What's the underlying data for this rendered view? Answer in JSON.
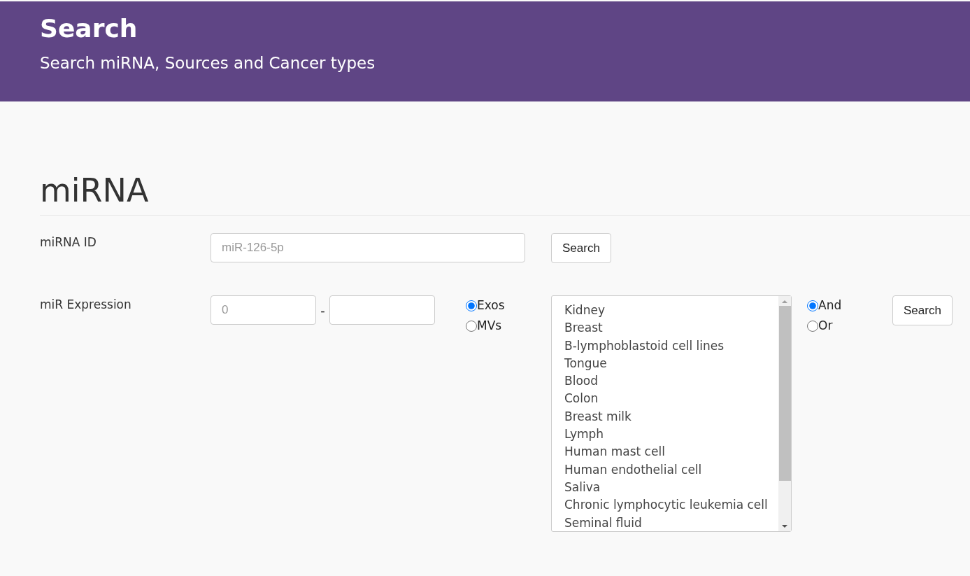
{
  "header": {
    "title": "Search",
    "subtitle": "Search miRNA, Sources and Cancer types"
  },
  "section": {
    "heading": "miRNA"
  },
  "id_row": {
    "label": "miRNA ID",
    "field": {
      "placeholder": "miR-126-5p"
    },
    "button": "Search"
  },
  "expression_row": {
    "label": "miR Expression",
    "min_field": {
      "placeholder": "0"
    },
    "separator": "-",
    "sources": [
      {
        "label": "Exos",
        "selected": true
      },
      {
        "label": "MVs",
        "selected": false
      }
    ],
    "tissues": [
      "Kidney",
      "Breast",
      "B-lymphoblastoid cell lines",
      "Tongue",
      "Blood",
      "Colon",
      "Breast milk",
      "Lymph",
      "Human mast cell",
      "Human endothelial cell",
      "Saliva",
      "Chronic lymphocytic leukemia cell",
      "Seminal fluid"
    ],
    "logic": [
      {
        "label": "And",
        "selected": true
      },
      {
        "label": "Or",
        "selected": false
      }
    ],
    "button": "Search"
  }
}
